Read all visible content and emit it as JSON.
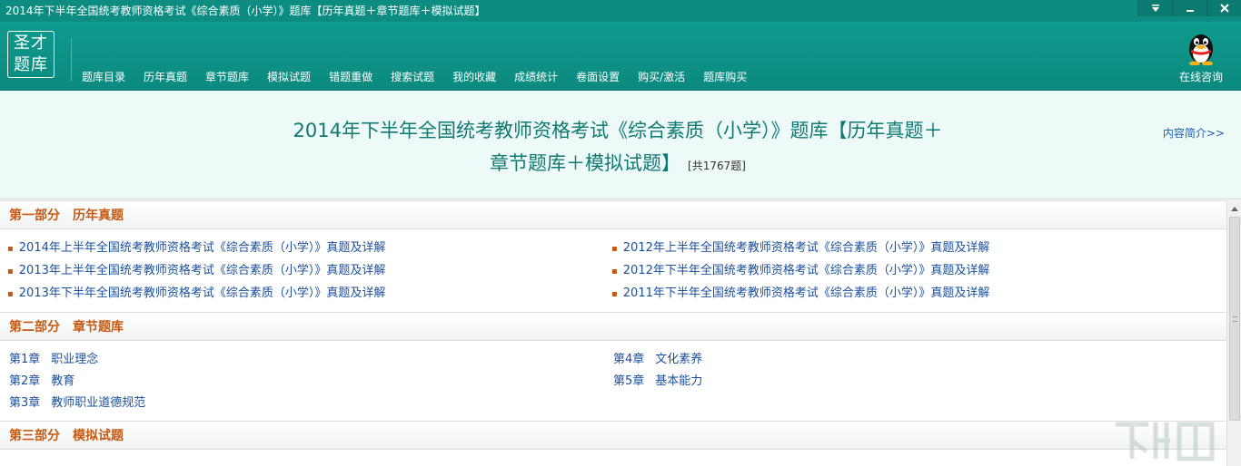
{
  "window": {
    "title": "2014年下半年全国统考教师资格考试《综合素质（小学）》题库【历年真题＋章节题库＋模拟试题】"
  },
  "logo": {
    "line1": "圣才",
    "line2": "题库"
  },
  "nav": {
    "items": [
      "题库目录",
      "历年真题",
      "章节题库",
      "模拟试题",
      "错题重做",
      "搜索试题",
      "我的收藏",
      "成绩统计",
      "卷面设置",
      "购买/激活",
      "题库购买"
    ],
    "consult_label": "在线咨询"
  },
  "hero": {
    "title_line1": "2014年下半年全国统考教师资格考试《综合素质（小学）》题库【历年真题＋",
    "title_line2": "章节题库＋模拟试题】",
    "count": "[共1767题]",
    "intro_link": "内容简介>>"
  },
  "sections": [
    {
      "part": "第一部分",
      "name": "历年真题",
      "items": [
        "2014年上半年全国统考教师资格考试《综合素质（小学）》真题及详解",
        "2012年上半年全国统考教师资格考试《综合素质（小学）》真题及详解",
        "2013年上半年全国统考教师资格考试《综合素质（小学）》真题及详解",
        "2012年下半年全国统考教师资格考试《综合素质（小学）》真题及详解",
        "2013年下半年全国统考教师资格考试《综合素质（小学）》真题及详解",
        "2011年下半年全国统考教师资格考试《综合素质（小学）》真题及详解"
      ]
    },
    {
      "part": "第二部分",
      "name": "章节题库",
      "chapters": [
        {
          "num": "第1章",
          "title": "职业理念"
        },
        {
          "num": "第4章",
          "title": "文化素养"
        },
        {
          "num": "第2章",
          "title": "教育"
        },
        {
          "num": "第5章",
          "title": "基本能力"
        },
        {
          "num": "第3章",
          "title": "教师职业道德规范"
        }
      ]
    },
    {
      "part": "第三部分",
      "name": "模拟试题"
    }
  ],
  "colors": {
    "brand_teal": "#0d8d82",
    "section_orange": "#c65a12",
    "link_blue": "#1a4f9c"
  }
}
